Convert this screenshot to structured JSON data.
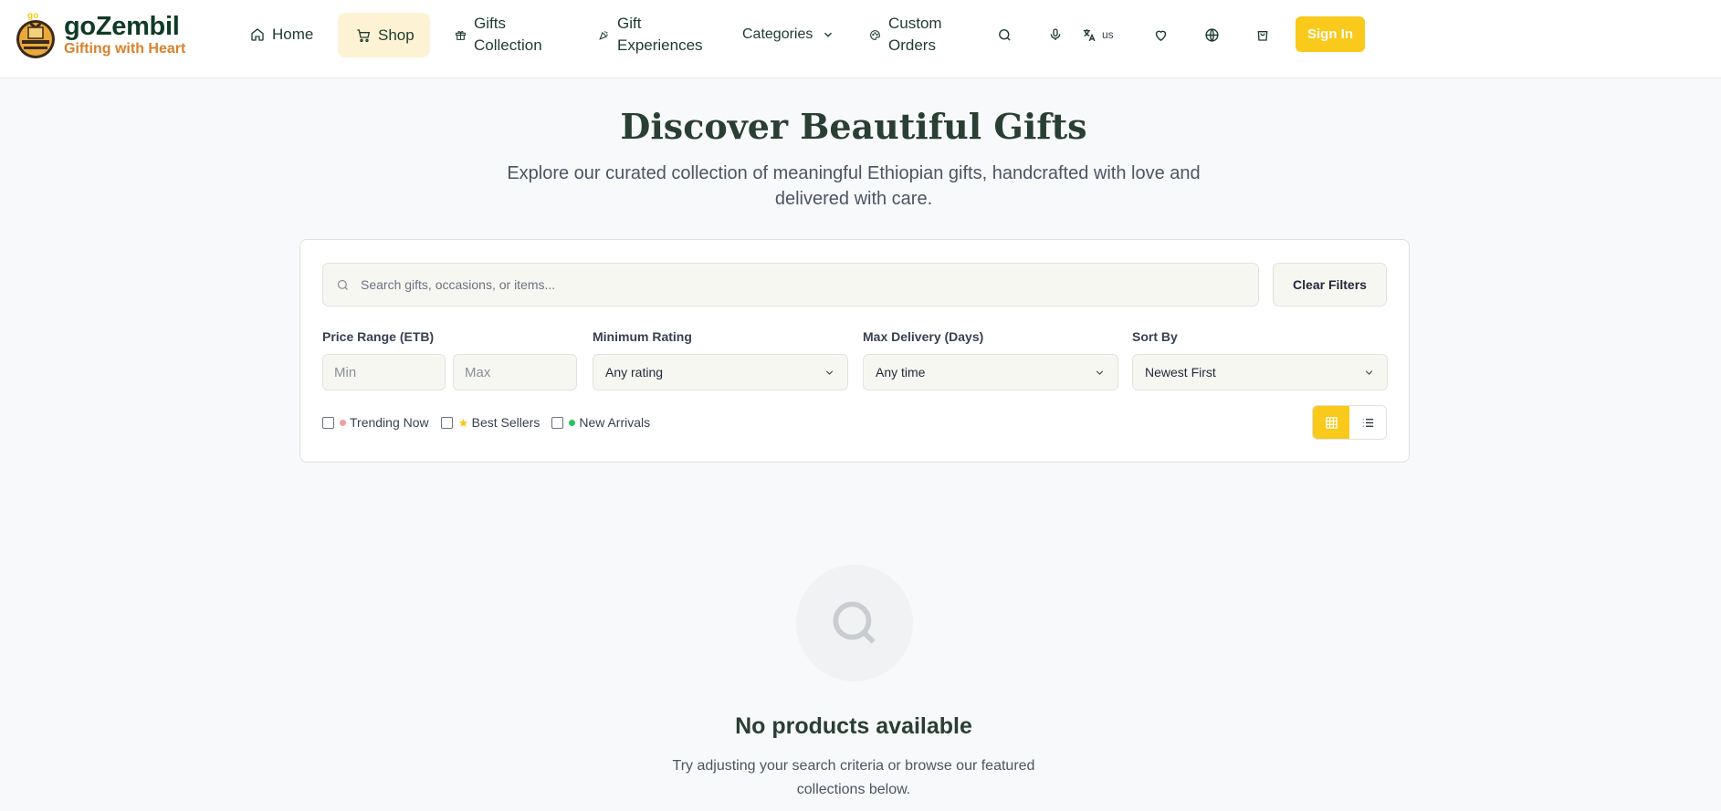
{
  "brand": {
    "name": "goZembil",
    "tagline": "Gifting with Heart",
    "logo_text": "go"
  },
  "nav": {
    "home": "Home",
    "shop": "Shop",
    "gifts_collection_1": "Gifts",
    "gifts_collection_2": "Collection",
    "gift_experiences_1": "Gift",
    "gift_experiences_2": "Experiences",
    "categories": "Categories",
    "custom_orders_1": "Custom",
    "custom_orders_2": "Orders"
  },
  "header_icons": {
    "language_code": "us"
  },
  "sign_in": "Sign In",
  "hero": {
    "title": "Discover Beautiful Gifts",
    "subtitle": "Explore our curated collection of meaningful Ethiopian gifts, handcrafted with love and delivered with care."
  },
  "filters": {
    "search_placeholder": "Search gifts, occasions, or items...",
    "clear_label": "Clear Filters",
    "price_label": "Price Range (ETB)",
    "min_placeholder": "Min",
    "max_placeholder": "Max",
    "rating_label": "Minimum Rating",
    "rating_value": "Any rating",
    "delivery_label": "Max Delivery (Days)",
    "delivery_value": "Any time",
    "sort_label": "Sort By",
    "sort_value": "Newest First",
    "trending": "Trending Now",
    "best_sellers": "Best Sellers",
    "new_arrivals": "New Arrivals"
  },
  "colors": {
    "accent": "#f9c91b",
    "brand_green": "#0f3b26",
    "tagline_orange": "#d9822b",
    "trending_dot": "#f0a0a0",
    "new_dot": "#22c55e"
  },
  "empty": {
    "title": "No products available",
    "subtitle": "Try adjusting your search criteria or browse our featured collections below."
  }
}
